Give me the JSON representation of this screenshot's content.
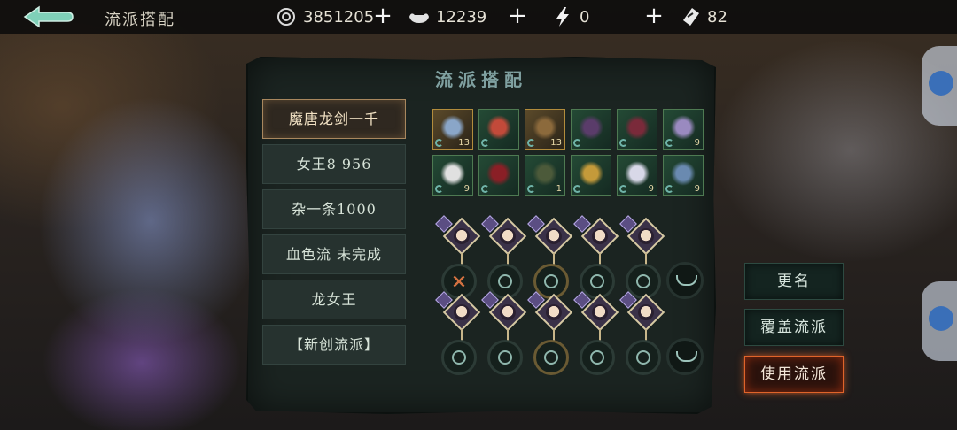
{
  "header": {
    "title": "流派搭配",
    "resources": [
      {
        "name": "coin",
        "value": "3851205",
        "icon": "coin-icon"
      },
      {
        "name": "silver-ingot",
        "value": "12239",
        "icon": "ingot-icon"
      },
      {
        "name": "stamina",
        "value": "0",
        "icon": "lightning-icon"
      },
      {
        "name": "ticket",
        "value": "82",
        "icon": "ticket-icon"
      }
    ]
  },
  "panel": {
    "title": "流派搭配",
    "schools": [
      {
        "label": "魔唐龙剑一千",
        "active": true
      },
      {
        "label": "女王8 956",
        "active": false
      },
      {
        "label": "杂一条1000",
        "active": false
      },
      {
        "label": "血色流 未完成",
        "active": false
      },
      {
        "label": "龙女王",
        "active": false
      },
      {
        "label": "【新创流派】",
        "active": false
      }
    ],
    "equipment": [
      {
        "name": "sword-item",
        "level": "13",
        "rarity": "gold"
      },
      {
        "name": "claw-item",
        "level": "",
        "rarity": "green"
      },
      {
        "name": "mask-item",
        "level": "13",
        "rarity": "gold"
      },
      {
        "name": "robe-item",
        "level": "",
        "rarity": "green"
      },
      {
        "name": "boots-item",
        "level": "",
        "rarity": "green"
      },
      {
        "name": "amulet-item",
        "level": "9",
        "rarity": "green"
      },
      {
        "name": "taiji-item",
        "level": "9",
        "rarity": "green"
      },
      {
        "name": "cape-item",
        "level": "",
        "rarity": "green"
      },
      {
        "name": "gauntlet-item",
        "level": "1",
        "rarity": "green"
      },
      {
        "name": "belt-item",
        "level": "",
        "rarity": "green"
      },
      {
        "name": "wing-item",
        "level": "9",
        "rarity": "green"
      },
      {
        "name": "staff-item",
        "level": "9",
        "rarity": "green"
      }
    ]
  },
  "actions": {
    "rename": "更名",
    "overwrite": "覆盖流派",
    "use": "使用流派"
  },
  "colors": {
    "accent_gold": "#a8875e",
    "use_button_glow": "#e0642a",
    "panel_bg": "#1b2421"
  }
}
